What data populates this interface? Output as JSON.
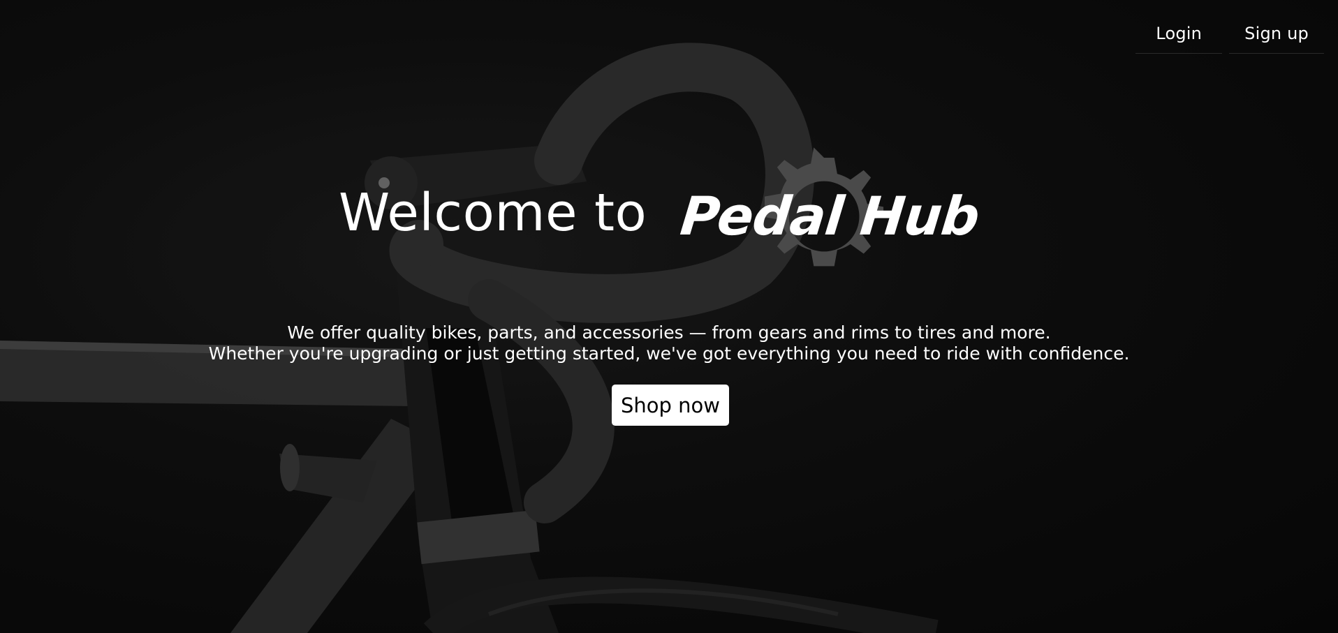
{
  "nav": {
    "login_label": "Login",
    "signup_label": "Sign up"
  },
  "hero": {
    "welcome_text": "Welcome to",
    "brand_name": "Pedal Hub",
    "tagline_line1": "We offer quality bikes, parts, and accessories — from gears and rims to tires and more.",
    "tagline_line2": "Whether you're upgrading or just getting started, we've got everything you need to ride with confidence.",
    "cta_label": "Shop now"
  },
  "colors": {
    "background": "#0c0c0c",
    "text": "#ffffff",
    "gear": "#4a4a4a",
    "button_bg": "#ffffff",
    "button_text": "#000000"
  },
  "icons": {
    "logo_gear": "gear-icon"
  }
}
